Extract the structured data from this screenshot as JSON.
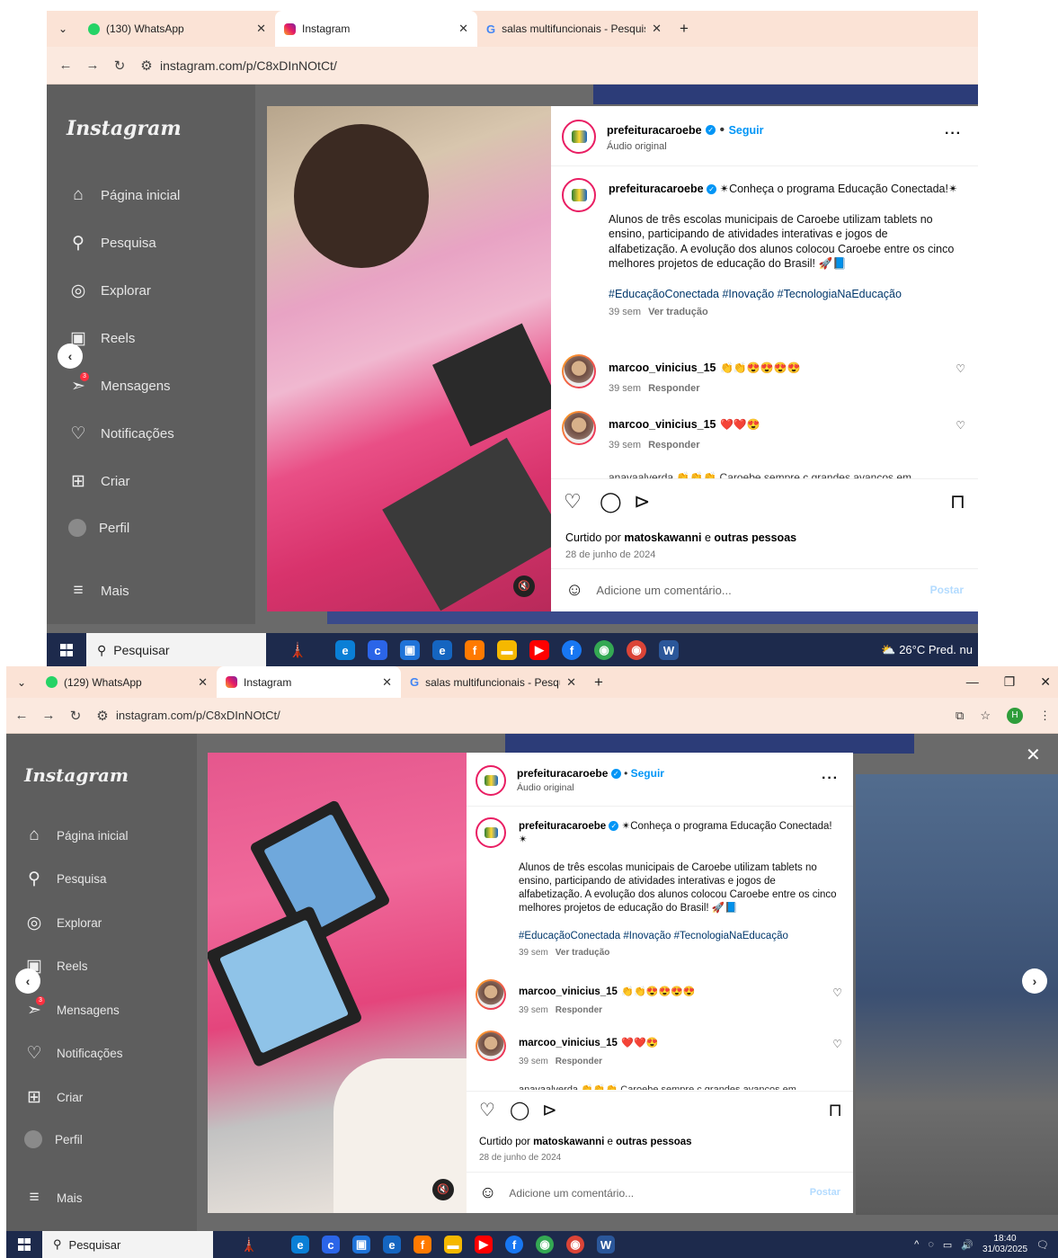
{
  "top": {
    "tabs": [
      {
        "label": "(130) WhatsApp"
      },
      {
        "label": "Instagram"
      },
      {
        "label": "salas multifuncionais - Pesquisa"
      }
    ],
    "url": "instagram.com/p/C8xDInNOtCt/",
    "taskbar": {
      "search": "Pesquisar",
      "weather": "26°C  Pred. nu"
    }
  },
  "bottom": {
    "tabs": [
      {
        "label": "(129) WhatsApp"
      },
      {
        "label": "Instagram"
      },
      {
        "label": "salas multifuncionais - Pesquisa"
      }
    ],
    "url": "instagram.com/p/C8xDInNOtCt/",
    "profile_initial": "H",
    "taskbar": {
      "search": "Pesquisar",
      "time": "18:40",
      "date": "31/03/2025"
    }
  },
  "sidebar": {
    "logo": "Instagram",
    "items": [
      {
        "label": "Página inicial",
        "icon": "home-icon"
      },
      {
        "label": "Pesquisa",
        "icon": "search-icon"
      },
      {
        "label": "Explorar",
        "icon": "compass-icon"
      },
      {
        "label": "Reels",
        "icon": "reels-icon"
      },
      {
        "label": "Mensagens",
        "icon": "messages-icon"
      },
      {
        "label": "Notificações",
        "icon": "heart-icon"
      },
      {
        "label": "Criar",
        "icon": "plus-square-icon"
      },
      {
        "label": "Perfil",
        "icon": "avatar"
      }
    ],
    "more": "Mais",
    "messages_badge": "3"
  },
  "post": {
    "username": "prefeituracaroebe",
    "follow": "Seguir",
    "audio": "Áudio original",
    "caption_first": "Conheça o programa Educação Conectada!",
    "caption_body": "Alunos de três escolas municipais de Caroebe utilizam tablets no ensino, participando de atividades interativas e jogos de alfabetização. A evolução dos alunos colocou Caroebe entre os cinco melhores projetos de educação do Brasil! 🚀📘",
    "hashtags": "#EducaçãoConectada #Inovação #TecnologiaNaEducação",
    "caption_time": "39 sem",
    "translate": "Ver tradução",
    "comments": [
      {
        "user": "marcoo_vinicius_15",
        "text": "👏👏😍😍😍😍",
        "time": "39 sem",
        "reply": "Responder"
      },
      {
        "user": "marcoo_vinicius_15",
        "text": "❤️❤️😍",
        "time": "39 sem",
        "reply": "Responder"
      }
    ],
    "truncated_comment": "anavaalverda 👏👏👏 Caroebe sempre c grandes avanços em",
    "liked_prefix": "Curtido por",
    "liked_user": "matoskawanni",
    "liked_and": "e",
    "liked_others": "outras pessoas",
    "date": "28 de junho de 2024",
    "add_comment": "Adicione um comentário...",
    "post_button": "Postar"
  },
  "colors": {
    "tabbar": "#fbe3d6",
    "accent": "#0095f6",
    "taskbar": "#1d2a4c"
  }
}
